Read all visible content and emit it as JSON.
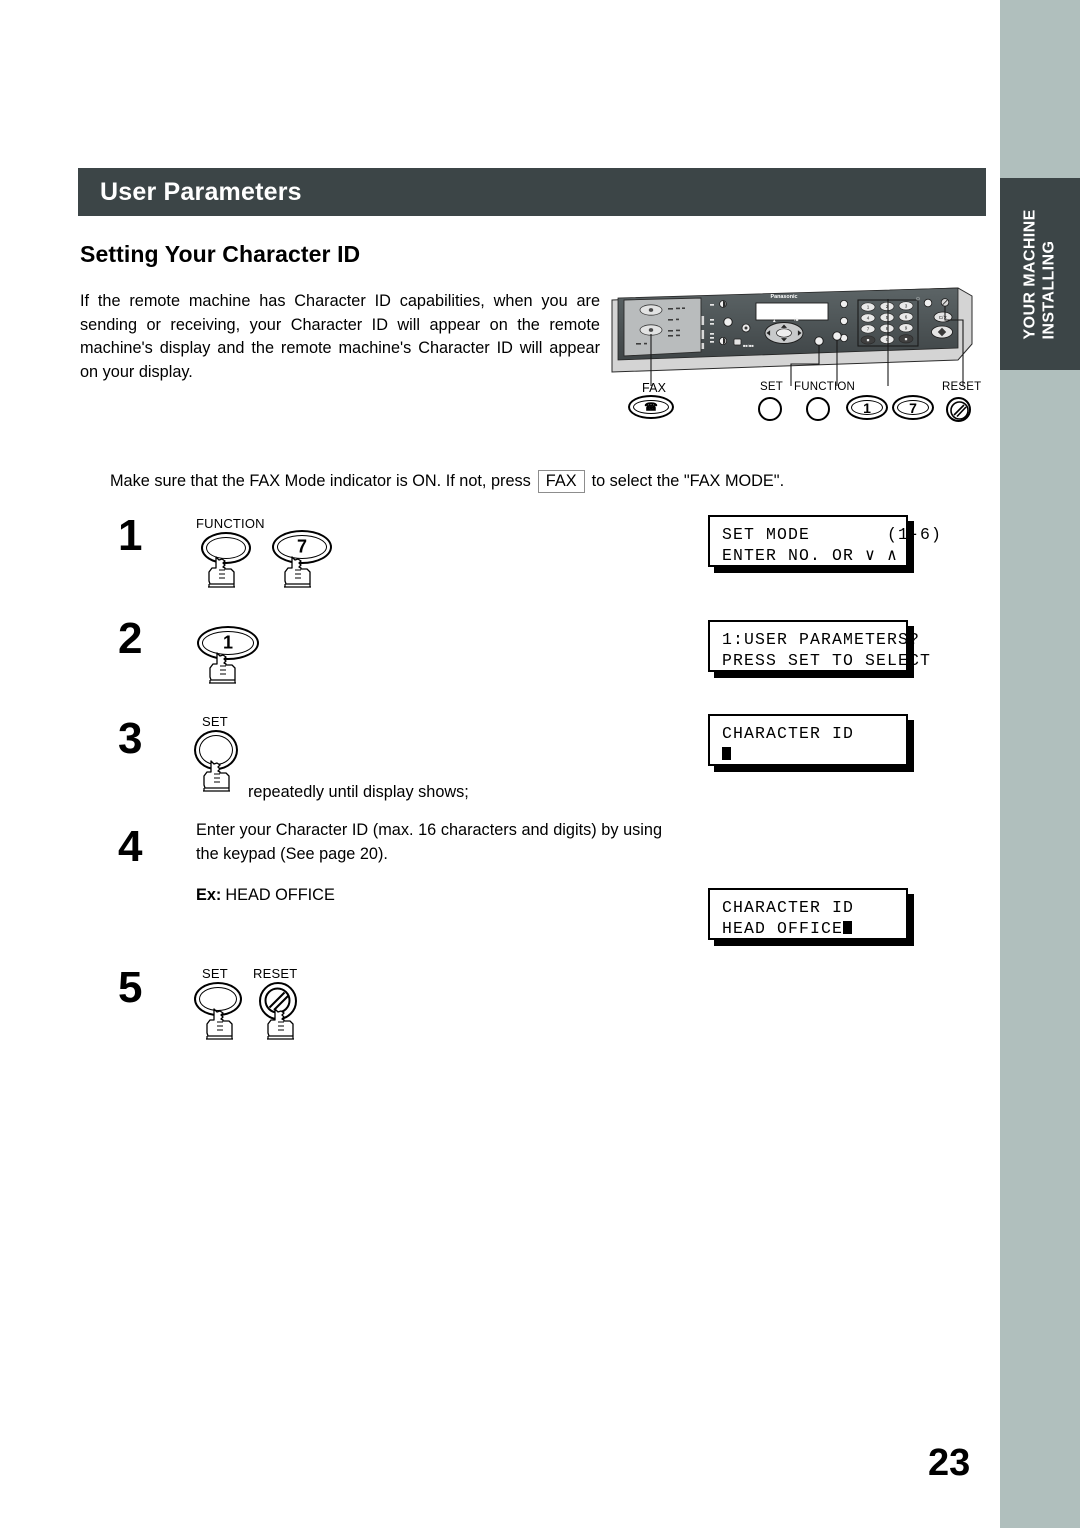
{
  "side_tab": {
    "line1": "INSTALLING",
    "line2": "YOUR MACHINE"
  },
  "header": {
    "title": "User Parameters"
  },
  "section": {
    "heading": "Setting Your Character ID"
  },
  "intro": {
    "paragraph": "If the remote machine has Character ID capabilities, when you are sending or receiving, your Character ID will appear on the remote machine's display and the remote machine's Character ID will appear on your display."
  },
  "machine": {
    "brand": "Panasonic",
    "callouts": [
      {
        "label": "FAX"
      },
      {
        "label": "SET"
      },
      {
        "label": "FUNCTION"
      },
      {
        "label": "1"
      },
      {
        "label": "7"
      },
      {
        "label": "RESET"
      }
    ],
    "keypad_keys": [
      "1",
      "2",
      "3",
      "4",
      "5",
      "6",
      "7",
      "8",
      "9",
      "*",
      "0",
      "#"
    ],
    "side_keys": [
      "C/✕"
    ]
  },
  "mode_line": {
    "before": "Make sure that the FAX Mode indicator is ON.  If not, press",
    "key": "FAX",
    "after": "to select the \"FAX MODE\"."
  },
  "steps": [
    {
      "number": "1",
      "keys": [
        {
          "label": "FUNCTION",
          "digit": ""
        },
        {
          "label": "",
          "digit": "7"
        }
      ],
      "text": ""
    },
    {
      "number": "2",
      "keys": [
        {
          "label": "",
          "digit": "1"
        }
      ],
      "text": ""
    },
    {
      "number": "3",
      "keys": [
        {
          "label": "SET",
          "digit": ""
        }
      ],
      "text": "repeatedly until display shows;"
    },
    {
      "number": "4",
      "keys": [],
      "text": "Enter your Character ID (max. 16 characters and digits) by using the keypad  (See page 20).",
      "example_label": "Ex:",
      "example_value": "HEAD OFFICE"
    },
    {
      "number": "5",
      "keys": [
        {
          "label": "SET",
          "digit": ""
        },
        {
          "label": "RESET",
          "digit": ""
        }
      ],
      "text": ""
    }
  ],
  "lcd_screens": [
    {
      "line1": "SET MODE       (1-6)",
      "line2": "ENTER NO. OR ∨ ∧",
      "cursor_after": ""
    },
    {
      "line1": "1:USER PARAMETERS?",
      "line2": "PRESS SET TO SELECT",
      "cursor_after": ""
    },
    {
      "line1": "CHARACTER ID",
      "line2": "",
      "cursor_after": "line2"
    },
    {
      "line1": "CHARACTER ID",
      "line2": "HEAD OFFICE",
      "cursor_after": "line2"
    }
  ],
  "page": {
    "number": "23"
  },
  "colors": {
    "header_bar": "#3c4547",
    "tab": "#3c4547",
    "edge_strip": "#b0bfbd"
  }
}
